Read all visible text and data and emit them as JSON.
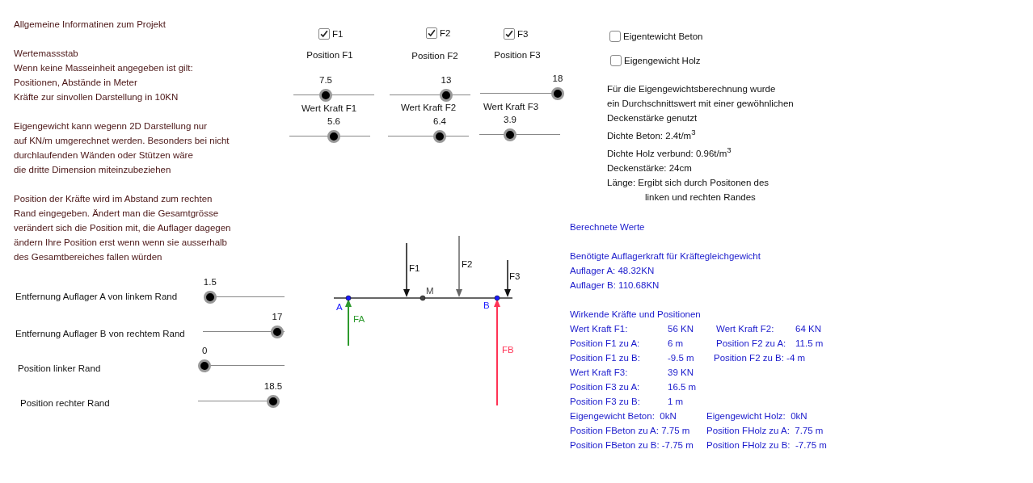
{
  "info_text": {
    "paragraphs": [
      [
        "Allgemeine Informatinen zum Projekt"
      ],
      [
        "Wertemassstab",
        "Wenn keine Masseinheit angegeben ist gilt:",
        "Positionen, Abstände in Meter",
        "Kräfte zur sinvollen Darstellung in 10KN"
      ],
      [
        "Eigengewicht kann wegenn 2D Darstellung nur",
        "auf KN/m umgerechnet werden. Besonders bei nicht",
        "durchlaufenden Wänden oder Stützen wäre",
        "die dritte Dimension miteinzubeziehen"
      ],
      [
        "Position der Kräfte wird im Abstand zum rechten",
        "Rand eingegeben. Ändert man die Gesamtgrösse",
        "verändert sich die Position mit, die Auflager dagegen",
        "ändern Ihre Position erst wenn wenn sie ausserhalb",
        "des Gesamtbereiches fallen würden"
      ]
    ]
  },
  "forces": [
    {
      "label": "F1",
      "checked": true,
      "position_label": "Position F1",
      "position": {
        "value": "7.5",
        "level": 0.4
      },
      "force_label": "Wert Kraft F1",
      "force": {
        "value": "5.6",
        "level": 0.55
      }
    },
    {
      "label": "F2",
      "checked": true,
      "position_label": "Position F2",
      "position": {
        "value": "13",
        "level": 0.7
      },
      "force_label": "Wert Kraft F2",
      "force": {
        "value": "6.4",
        "level": 0.64
      }
    },
    {
      "label": "F3",
      "checked": true,
      "position_label": "Position F3",
      "position": {
        "value": "18",
        "level": 0.96
      },
      "force_label": "Wert Kraft F3",
      "force": {
        "value": "3.9",
        "level": 0.38
      }
    }
  ],
  "self_weight": [
    {
      "label": "Eigentewicht Beton",
      "checked": false
    },
    {
      "label": "Eigengewicht Holz",
      "checked": false
    }
  ],
  "note": {
    "lines": [
      {
        "text": "Für die Eigengewichtsberechnung wurde",
        "indent": false
      },
      {
        "text": "ein Durchschnittswert mit einer gewöhnlichen",
        "indent": false
      },
      {
        "text": "Deckenstärke genutzt",
        "indent": false
      },
      {
        "text": "Dichte Beton: 2.4t/m$^{3}$",
        "indent": false
      },
      {
        "text": "Dichte Holz verbund: 0.96t/m$^{3}$",
        "indent": false
      },
      {
        "text": "Deckenstärke: 24cm",
        "indent": false
      },
      {
        "text": "Länge: Ergibt sich durch Positonen des",
        "indent": false
      },
      {
        "text": "linken und rechten Randes",
        "indent": true
      }
    ]
  },
  "support_sliders": [
    {
      "label": "Entfernung Auflager A von linkem Rand",
      "value": "1.5",
      "level": 0.05
    },
    {
      "label": "Entfernung Auflager B von rechtem Rand",
      "value": "17",
      "level": 0.91
    },
    {
      "label": "Position linker Rand",
      "value": "0",
      "level": 0.04
    },
    {
      "label": "Position rechter Rand",
      "value": "18.5",
      "level": 0.93
    }
  ],
  "diagram": {
    "points": [
      {
        "label": "A"
      },
      {
        "label": "M"
      },
      {
        "label": "B"
      }
    ],
    "loads": [
      {
        "label": "F1"
      },
      {
        "label": "F2"
      },
      {
        "label": "F3"
      }
    ],
    "reactions": [
      {
        "label": "FA",
        "color": "#2e9a2e"
      },
      {
        "label": "FB",
        "color": "#ff3355"
      }
    ]
  },
  "results": {
    "title": "Berechnete Werte",
    "support_heading": "Benötigte Auflagerkraft für Kräftegleichgewicht",
    "supports": [
      "Auflager A: 48.32KN",
      "Auflager B: 110.68KN"
    ],
    "forces_heading": "Wirkende Kräfte und Positionen",
    "rows": [
      {
        "kind": "aligned",
        "cells": [
          "Wert Kraft F1:",
          "56 KN",
          "Wert Kraft F2:",
          "64 KN"
        ]
      },
      {
        "kind": "aligned",
        "cells": [
          "Position F1 zu A:",
          "6 m",
          "Position F2 zu A:",
          "11.5 m"
        ]
      },
      {
        "kind": "aligned",
        "cells": [
          "Position F1 zu B:",
          "-9.5 m",
          "Position F2 zu B: -4 m"
        ]
      },
      {
        "kind": "aligned",
        "cells": [
          "Wert Kraft F3:",
          "39 KN"
        ]
      },
      {
        "kind": "aligned",
        "cells": [
          "Position F3 zu A:",
          "16.5 m"
        ]
      },
      {
        "kind": "aligned",
        "cells": [
          "Position F3 zu B:",
          "1 m"
        ]
      },
      {
        "kind": "inline",
        "cells": [
          "Eigengewicht Beton:  0kN",
          "Eigengewicht Holz:  0kN"
        ]
      },
      {
        "kind": "inline",
        "cells": [
          "Position FBeton zu A: 7.75 m",
          "Position FHolz zu A:  7.75 m"
        ]
      },
      {
        "kind": "inline",
        "cells": [
          "Position FBeton zu B: -7.75 m",
          "Position FHolz zu B:  -7.75 m"
        ]
      }
    ]
  }
}
